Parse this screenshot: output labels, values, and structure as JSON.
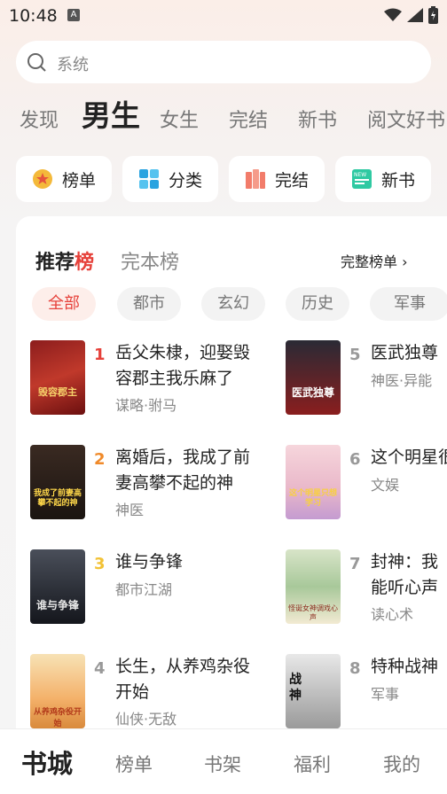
{
  "status_bar": {
    "time": "10:48",
    "notification_icon": "A"
  },
  "search": {
    "placeholder": "系统"
  },
  "category_tabs": [
    {
      "label": "发现"
    },
    {
      "label": "男生"
    },
    {
      "label": "女生"
    },
    {
      "label": "完结"
    },
    {
      "label": "新书"
    },
    {
      "label": "阅文好书"
    }
  ],
  "active_category": "男生",
  "shortcuts": [
    {
      "label": "榜单",
      "icon": "medal-icon"
    },
    {
      "label": "分类",
      "icon": "grid-icon"
    },
    {
      "label": "完结",
      "icon": "books-icon"
    },
    {
      "label": "新书",
      "icon": "new-book-icon"
    }
  ],
  "ranking": {
    "tabs": [
      {
        "label_main": "推荐",
        "label_hl": "榜"
      },
      {
        "label": "完本榜"
      }
    ],
    "full_list_label": "完整榜单",
    "genres": [
      "全部",
      "都市",
      "玄幻",
      "历史",
      "军事"
    ],
    "active_genre": "全部",
    "books": [
      {
        "rank": "1",
        "title": "岳父朱棣，迎娶毁容郡主我乐麻了",
        "tag": "谋略·驸马",
        "cover_text": "毁容郡主"
      },
      {
        "rank": "2",
        "title": "离婚后，我成了前妻高攀不起的神",
        "tag": "神医",
        "cover_text": "我成了前妻高攀不起的神"
      },
      {
        "rank": "3",
        "title": "谁与争锋",
        "tag": "都市江湖",
        "cover_text": "谁与争锋"
      },
      {
        "rank": "4",
        "title": "长生，从养鸡杂役开始",
        "tag": "仙侠·无敌",
        "cover_text": "从养鸡杂役开始"
      },
      {
        "rank": "5",
        "title": "医武独尊",
        "tag": "神医·异能",
        "cover_text": "医武独尊"
      },
      {
        "rank": "6",
        "title": "这个明星很想退休",
        "tag": "文娱",
        "cover_text": "这个明星只想学习"
      },
      {
        "rank": "7",
        "title": "封神：我能听心声",
        "tag": "读心术",
        "cover_text": "怪诞女神调戏心声"
      },
      {
        "rank": "8",
        "title": "特种战神",
        "tag": "军事",
        "cover_text": "战神"
      }
    ],
    "rank_colors": {
      "1": "#e6413a",
      "2": "#f08a2a",
      "3": "#f2c236",
      "other": "#999999"
    }
  },
  "bottom_nav": [
    {
      "label": "书城"
    },
    {
      "label": "榜单"
    },
    {
      "label": "书架"
    },
    {
      "label": "福利"
    },
    {
      "label": "我的"
    }
  ],
  "active_nav": "书城"
}
